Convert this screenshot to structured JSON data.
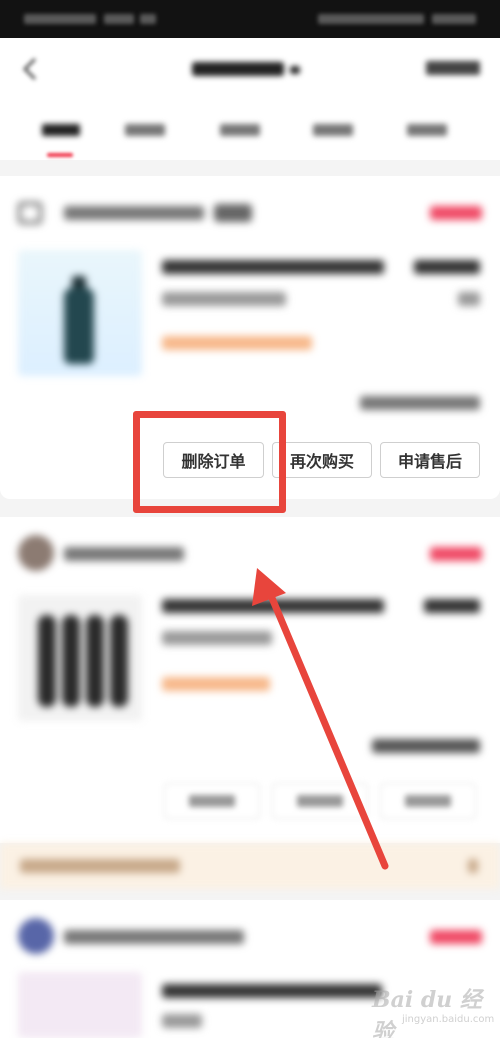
{
  "order_actions": {
    "delete_order": "删除订单",
    "buy_again": "再次购买",
    "after_sale": "申请售后"
  },
  "colors": {
    "annotation": "#e8453c",
    "accent": "#f0354a",
    "status": "#f04a66"
  },
  "icons": {
    "back": "back-arrow-icon",
    "shop": "shop-icon"
  },
  "annotation": {
    "highlight_target": "delete_order",
    "arrow_points_to": "delete_order"
  },
  "watermark": {
    "main": "Bai du 经验",
    "sub": "jingyan.baidu.com"
  }
}
